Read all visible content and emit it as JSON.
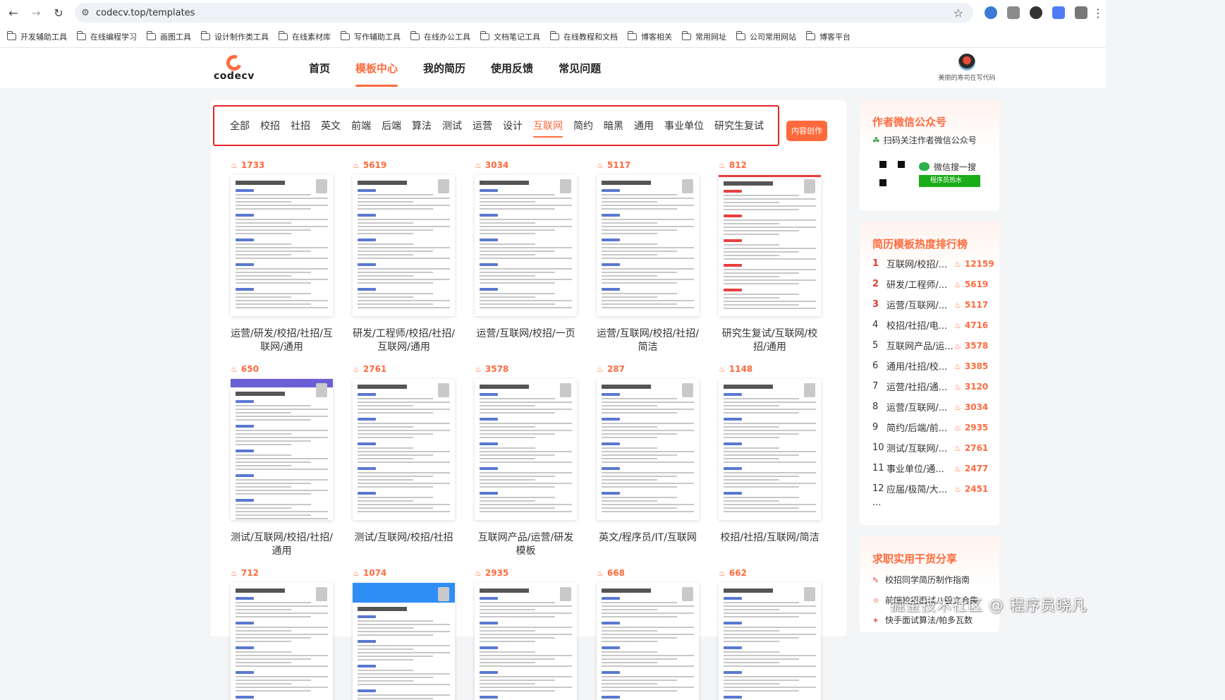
{
  "browser": {
    "url": "codecv.top/templates",
    "bookmarks": [
      "开发辅助工具",
      "在线编程学习",
      "画图工具",
      "设计制作类工具",
      "在线素材库",
      "写作辅助工具",
      "在线办公工具",
      "文档笔记工具",
      "在线教程和文档",
      "博客相关",
      "常用网址",
      "公司常用网站",
      "博客平台"
    ]
  },
  "header": {
    "logo_text": "codecv",
    "nav": [
      "首页",
      "模板中心",
      "我的简历",
      "使用反馈",
      "常见问题"
    ],
    "active_nav": "模板中心",
    "username": "美丽的寿司在写代码"
  },
  "categories": {
    "items": [
      "全部",
      "校招",
      "社招",
      "英文",
      "前端",
      "后端",
      "算法",
      "测试",
      "运营",
      "设计",
      "互联网",
      "简约",
      "暗黑",
      "通用",
      "事业单位",
      "研究生复试"
    ],
    "active": "互联网",
    "create_button": "内容创作"
  },
  "templates": [
    {
      "heat": "1733",
      "title": "运营/研发/校招/社招/互联网/通用",
      "style": "plain"
    },
    {
      "heat": "5619",
      "title": "研发/工程师/校招/社招/互联网/通用",
      "style": "plain"
    },
    {
      "heat": "3034",
      "title": "运营/互联网/校招/一页",
      "style": "plain"
    },
    {
      "heat": "5117",
      "title": "运营/互联网/校招/社招/简洁",
      "style": "plain"
    },
    {
      "heat": "812",
      "title": "研究生复试/互联网/校招/通用",
      "style": "red"
    },
    {
      "heat": "650",
      "title": "测试/互联网/校招/社招/通用",
      "style": "purple"
    },
    {
      "heat": "2761",
      "title": "测试/互联网/校招/社招",
      "style": "plain"
    },
    {
      "heat": "3578",
      "title": "互联网产品/运营/研发模板",
      "style": "plain"
    },
    {
      "heat": "287",
      "title": "英文/程序员/IT/互联网",
      "style": "plain"
    },
    {
      "heat": "1148",
      "title": "校招/社招/互联网/简洁",
      "style": "plain"
    },
    {
      "heat": "712",
      "title": "",
      "style": "plain"
    },
    {
      "heat": "1074",
      "title": "",
      "style": "blue"
    },
    {
      "heat": "2935",
      "title": "",
      "style": "plain"
    },
    {
      "heat": "668",
      "title": "",
      "style": "plain"
    },
    {
      "heat": "662",
      "title": "",
      "style": "plain"
    }
  ],
  "sidebar": {
    "wechat": {
      "title": "作者微信公众号",
      "subtitle": "扫码关注作者微信公众号",
      "search_label": "微信搜一搜",
      "search_button": "程序员热水"
    },
    "ranking": {
      "title": "简历模板热度排行榜",
      "items": [
        {
          "rank": "1",
          "name": "互联网/校招/...",
          "hot": "12159"
        },
        {
          "rank": "2",
          "name": "研发/工程师/...",
          "hot": "5619"
        },
        {
          "rank": "3",
          "name": "运营/互联网/...",
          "hot": "5117"
        },
        {
          "rank": "4",
          "name": "校招/社招/电...",
          "hot": "4716"
        },
        {
          "rank": "5",
          "name": "互联网产品/运...",
          "hot": "3578"
        },
        {
          "rank": "6",
          "name": "通用/社招/校...",
          "hot": "3385"
        },
        {
          "rank": "7",
          "name": "运营/社招/通...",
          "hot": "3120"
        },
        {
          "rank": "8",
          "name": "运营/互联网/...",
          "hot": "3034"
        },
        {
          "rank": "9",
          "name": "简约/后端/前...",
          "hot": "2935"
        },
        {
          "rank": "10",
          "name": "测试/互联网/...",
          "hot": "2761"
        },
        {
          "rank": "11",
          "name": "事业单位/通...",
          "hot": "2477"
        },
        {
          "rank": "12",
          "name": "应届/极简/大...",
          "hot": "2451"
        }
      ],
      "more": "..."
    },
    "share": {
      "title": "求职实用干货分享",
      "items": [
        "校招同学简历制作指南",
        "前端校招面试八股文合集",
        "快手面试算法/帕多瓦数"
      ]
    }
  },
  "watermark": "掘金技术社区 @ 程序员晓凡"
}
